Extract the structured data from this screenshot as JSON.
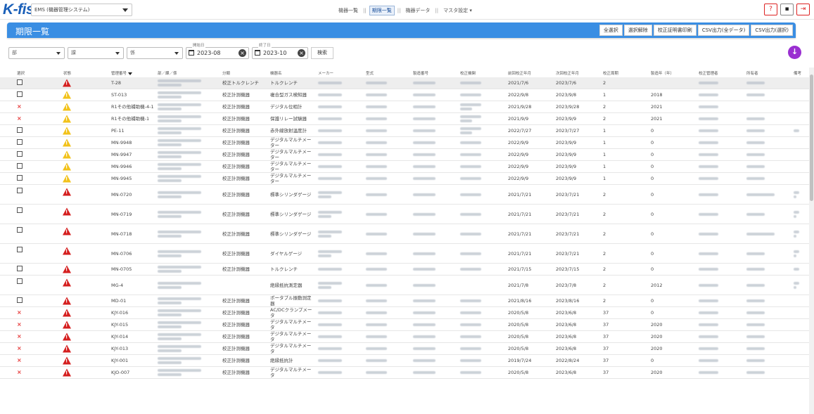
{
  "app": {
    "logo": "K-fis",
    "system_select": "EMS (機器管理システム)",
    "nav": [
      "機器一覧",
      "期限一覧",
      "機器データ",
      "マスタ設定"
    ],
    "nav_active": "期限一覧",
    "nav_separator": "||",
    "icons": [
      "help-icon",
      "user-card-icon",
      "logout-icon"
    ]
  },
  "page": {
    "title": "期限一覧",
    "buttons": [
      "全選択",
      "選択解除",
      "校正証明書印刷",
      "CSV出力(全データ)",
      "CSV出力(選択)"
    ]
  },
  "filters": {
    "bu": "部",
    "ka": "課",
    "kakari": "係",
    "start_label": "開始日",
    "start_value": "2023-08",
    "end_label": "終了日",
    "end_value": "2023-10",
    "search": "検索"
  },
  "table": {
    "headers": [
      "選択",
      "状態",
      "管理番号",
      "部／課／係",
      "分類",
      "機器名",
      "メーカー",
      "型式",
      "製造番号",
      "校正機関",
      "前回校正年月",
      "次回校正年月",
      "校正周期",
      "製造年（年）",
      "校正管理者",
      "所有者",
      "備考"
    ],
    "rows": [
      {
        "sel": "box",
        "status": "red",
        "id": "T-28",
        "cat": "校正トルクレンチ",
        "name": "トルクレンチ",
        "prev": "2021/7/6",
        "next": "2023/7/6",
        "cycle": "2",
        "year": ""
      },
      {
        "sel": "box",
        "status": "yellow",
        "id": "ST-013",
        "cat": "校正計測機器",
        "name": "複合型ガス検知器",
        "prev": "2022/9/8",
        "next": "2023/9/8",
        "cycle": "1",
        "year": "2018"
      },
      {
        "sel": "x",
        "status": "yellow",
        "id": "R1その他補助機-4-1",
        "cat": "校正計測機器",
        "name": "デジタル位相計",
        "prev": "2021/9/28",
        "next": "2023/9/28",
        "cycle": "2",
        "year": "2021"
      },
      {
        "sel": "x",
        "status": "yellow",
        "id": "R1その他補助機-1",
        "cat": "校正計測機器",
        "name": "保護リレー試験器",
        "prev": "2021/9/9",
        "next": "2023/9/9",
        "cycle": "2",
        "year": "2021"
      },
      {
        "sel": "box",
        "status": "yellow",
        "id": "PE-11",
        "cat": "校正計測機器",
        "name": "赤外線放射温度計",
        "prev": "2022/7/27",
        "next": "2023/7/27",
        "cycle": "1",
        "year": "0"
      },
      {
        "sel": "box",
        "status": "yellow",
        "id": "MN-9948",
        "cat": "校正計測機器",
        "name": "デジタルマルチメーター",
        "prev": "2022/9/9",
        "next": "2023/9/9",
        "cycle": "1",
        "year": "0"
      },
      {
        "sel": "box",
        "status": "yellow",
        "id": "MN-9947",
        "cat": "校正計測機器",
        "name": "デジタルマルチメーター",
        "prev": "2022/9/9",
        "next": "2023/9/9",
        "cycle": "1",
        "year": "0"
      },
      {
        "sel": "box",
        "status": "yellow",
        "id": "MN-9946",
        "cat": "校正計測機器",
        "name": "デジタルマルチメーター",
        "prev": "2022/9/9",
        "next": "2023/9/9",
        "cycle": "1",
        "year": "0"
      },
      {
        "sel": "box",
        "status": "yellow",
        "id": "MN-9945",
        "cat": "校正計測機器",
        "name": "デジタルマルチメーター",
        "prev": "2022/9/9",
        "next": "2023/9/9",
        "cycle": "1",
        "year": "0"
      },
      {
        "sel": "box",
        "status": "red",
        "id": "MN-0720",
        "cat": "校正計測機器",
        "name": "標準シリンダゲージ",
        "prev": "2021/7/21",
        "next": "2023/7/21",
        "cycle": "2",
        "year": "0"
      },
      {
        "sel": "box",
        "status": "red",
        "id": "MN-0719",
        "cat": "校正計測機器",
        "name": "標準シリンダゲージ",
        "prev": "2021/7/21",
        "next": "2023/7/21",
        "cycle": "2",
        "year": "0"
      },
      {
        "sel": "box",
        "status": "red",
        "id": "MN-0718",
        "cat": "校正計測機器",
        "name": "標準シリンダゲージ",
        "prev": "2021/7/21",
        "next": "2023/7/21",
        "cycle": "2",
        "year": "0"
      },
      {
        "sel": "box",
        "status": "red",
        "id": "MN-0706",
        "cat": "校正計測機器",
        "name": "ダイヤルゲージ",
        "prev": "2021/7/21",
        "next": "2023/7/21",
        "cycle": "2",
        "year": "0"
      },
      {
        "sel": "box",
        "status": "red",
        "id": "MN-0705",
        "cat": "校正計測機器",
        "name": "トルクレンチ",
        "prev": "2021/7/15",
        "next": "2023/7/15",
        "cycle": "2",
        "year": "0"
      },
      {
        "sel": "box",
        "status": "red",
        "id": "MG-4",
        "cat": "",
        "name": "絶縁抵抗測定器",
        "prev": "2021/7/8",
        "next": "2023/7/8",
        "cycle": "2",
        "year": "2012"
      },
      {
        "sel": "box",
        "status": "red",
        "id": "MD-01",
        "cat": "校正計測機器",
        "name": "ポータブル振動測定器",
        "prev": "2021/8/16",
        "next": "2023/8/16",
        "cycle": "2",
        "year": "0"
      },
      {
        "sel": "x",
        "status": "red",
        "id": "KJY-016",
        "cat": "校正計測機器",
        "name": "AC/DCクランプメータ",
        "prev": "2020/5/8",
        "next": "2023/6/8",
        "cycle": "37",
        "year": "0"
      },
      {
        "sel": "x",
        "status": "red",
        "id": "KJY-015",
        "cat": "校正計測機器",
        "name": "デジタルマルチメータ",
        "prev": "2020/5/8",
        "next": "2023/6/8",
        "cycle": "37",
        "year": "2020"
      },
      {
        "sel": "x",
        "status": "red",
        "id": "KJY-014",
        "cat": "校正計測機器",
        "name": "デジタルマルチメータ",
        "prev": "2020/5/8",
        "next": "2023/6/8",
        "cycle": "37",
        "year": "2020"
      },
      {
        "sel": "x",
        "status": "red",
        "id": "KJY-013",
        "cat": "校正計測機器",
        "name": "デジタルマルチメータ",
        "prev": "2020/5/8",
        "next": "2023/6/8",
        "cycle": "37",
        "year": "2020"
      },
      {
        "sel": "x",
        "status": "red",
        "id": "KJY-001",
        "cat": "校正計測機器",
        "name": "絶縁抵抗計",
        "prev": "2019/7/24",
        "next": "2022/8/24",
        "cycle": "37",
        "year": "0"
      },
      {
        "sel": "x",
        "status": "red",
        "id": "KJO-007",
        "cat": "校正計測機器",
        "name": "デジタルマルチメータ",
        "prev": "2020/5/8",
        "next": "2023/6/8",
        "cycle": "37",
        "year": "2020"
      }
    ]
  },
  "colors": {
    "title_bar": "#3a8ee3",
    "fab": "#9a2fd1",
    "warn_red": "#d51f1f",
    "warn_yellow": "#f2c21a",
    "x_mark": "#e53333"
  }
}
